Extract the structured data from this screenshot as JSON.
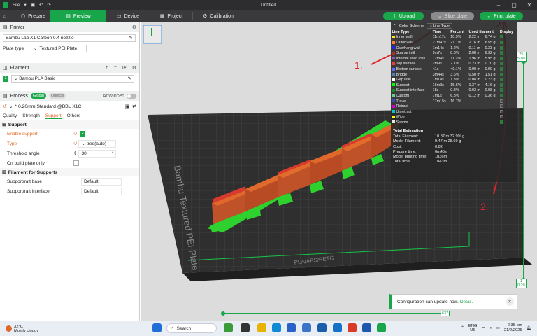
{
  "titlebar": {
    "menu": "File",
    "title": "Untitled"
  },
  "tabs": [
    {
      "label": "Prepare"
    },
    {
      "label": "Preview"
    },
    {
      "label": "Device"
    },
    {
      "label": "Project"
    },
    {
      "label": "Calibration"
    }
  ],
  "actions": {
    "upload": "Upload",
    "slice": "Slice plate",
    "print": "Print plate"
  },
  "printer": {
    "section": "Printer",
    "name": "Bambu Lab X1 Carbon 0.4 nozzle",
    "plate_type_label": "Plate type",
    "plate_type": "Textured PEI Plate"
  },
  "filament": {
    "section": "Filament",
    "slot": "1",
    "name": "Bambu PLA Basic"
  },
  "process": {
    "section": "Process",
    "global": "Global",
    "objects": "Objects",
    "advanced": "Advanced",
    "preset": "* 0.20mm Standard @BBL X1C",
    "subtabs": [
      "Quality",
      "Strength",
      "Support",
      "Others"
    ]
  },
  "support": {
    "group": "Support",
    "enable_label": "Enable support",
    "type_label": "Type",
    "type_value": "tree(auto)",
    "threshold_label": "Threshold angle",
    "threshold_value": "30",
    "threshold_unit": "°",
    "build_plate_label": "On build plate only",
    "filament_group": "Filament for Supports",
    "base_label": "Support/raft base",
    "base_value": "Default",
    "interface_label": "Support/raft interface",
    "interface_value": "Default"
  },
  "legend": {
    "scheme_label": "Color Scheme",
    "scheme_value": "Line Type",
    "headers": [
      "Line Type",
      "Time",
      "Percent",
      "Used filament",
      "Display"
    ],
    "rows": [
      {
        "name": "Inner wall",
        "time": "11m17s",
        "pct": "10.9%",
        "len": "2.22 m",
        "wt": "6.74 g",
        "color": "#ffe41f",
        "on": true
      },
      {
        "name": "Outer wall",
        "time": "21m47s",
        "pct": "21.1%",
        "len": "2.16 m",
        "wt": "6.55 g",
        "color": "#ff7d38",
        "on": true
      },
      {
        "name": "Overhang wall",
        "time": "1m14s",
        "pct": "1.2%",
        "len": "0.11 m",
        "wt": "0.33 g",
        "color": "#1f1fff",
        "on": true
      },
      {
        "name": "Sparse infill",
        "time": "9m7s",
        "pct": "8.8%",
        "len": "2.08 m",
        "wt": "6.32 g",
        "color": "#b03029",
        "on": true
      },
      {
        "name": "Internal solid infill",
        "time": "12m4s",
        "pct": "11.7%",
        "len": "1.96 m",
        "wt": "5.95 g",
        "color": "#9654cc",
        "on": true
      },
      {
        "name": "Top surface",
        "time": "2m9s",
        "pct": "2.1%",
        "len": "0.23 m",
        "wt": "0.70 g",
        "color": "#f03c3c",
        "on": true
      },
      {
        "name": "Bottom surface",
        "time": "<1s",
        "pct": "<0.1%",
        "len": "0.00 m",
        "wt": "0.00 g",
        "color": "#6666ff",
        "on": true
      },
      {
        "name": "Bridge",
        "time": "3m44s",
        "pct": "3.6%",
        "len": "0.50 m",
        "wt": "1.51 g",
        "color": "#4d80ba",
        "on": true
      },
      {
        "name": "Gap infill",
        "time": "1m18s",
        "pct": "1.3%",
        "len": "0.08 m",
        "wt": "0.23 g",
        "color": "#ffffff",
        "on": true
      },
      {
        "name": "Support",
        "time": "16m8s",
        "pct": "15.6%",
        "len": "1.37 m",
        "wt": "4.16 g",
        "color": "#00ff00",
        "on": true
      },
      {
        "name": "Support interface",
        "time": "18s",
        "pct": "0.3%",
        "len": "0.03 m",
        "wt": "0.08 g",
        "color": "#128c12",
        "on": true
      },
      {
        "name": "Custom",
        "time": "7m1s",
        "pct": "6.8%",
        "len": "0.12 m",
        "wt": "0.36 g",
        "color": "#5ed194",
        "on": true
      },
      {
        "name": "Travel",
        "time": "17m15s",
        "pct": "16.7%",
        "len": "",
        "wt": "",
        "color": "#384cb8",
        "on": false
      },
      {
        "name": "Retract",
        "time": "",
        "pct": "",
        "len": "",
        "wt": "",
        "color": "#cd00cd",
        "on": false
      },
      {
        "name": "Unretract",
        "time": "",
        "pct": "",
        "len": "",
        "wt": "",
        "color": "#00c8c8",
        "on": false
      },
      {
        "name": "Wipe",
        "time": "",
        "pct": "",
        "len": "",
        "wt": "",
        "color": "#ffff00",
        "on": false
      },
      {
        "name": "Seams",
        "time": "",
        "pct": "",
        "len": "",
        "wt": "",
        "color": "#e6e6e6",
        "on": true
      }
    ],
    "totals_head": "Total Estimation",
    "totals": [
      {
        "k": "Total Filament:",
        "v": "10.87 m    32.9% g"
      },
      {
        "k": "Model Filament:",
        "v": "9.47 m     28.69 g"
      },
      {
        "k": "Cost:",
        "v": "0.82"
      },
      {
        "k": "Prepare time:",
        "v": "6m45s"
      },
      {
        "k": "Model printing time:",
        "v": "1h36m"
      },
      {
        "k": "Total time:",
        "v": "1h43m"
      }
    ]
  },
  "plate_text": "Bambu Textured PEI Plate",
  "plate_front_text": "PLA/ABS/PETG",
  "layer_slider": {
    "top": "25",
    "top_height": "5.00",
    "bottom": "1",
    "bottom_height": "0.20"
  },
  "h_slider_value": "637",
  "annotations": {
    "one": "1.",
    "two": "2."
  },
  "notification": {
    "text": "Configuration can update now.",
    "link": "Detail."
  },
  "taskbar": {
    "temp": "32°C",
    "weather": "Mostly cloudy",
    "search": "Search",
    "lang": "ENG",
    "region": "US",
    "time": "2:38 pm",
    "date": "21/2/2025"
  },
  "colors": {
    "accent": "#19a64a",
    "annotation": "#e0252a"
  }
}
